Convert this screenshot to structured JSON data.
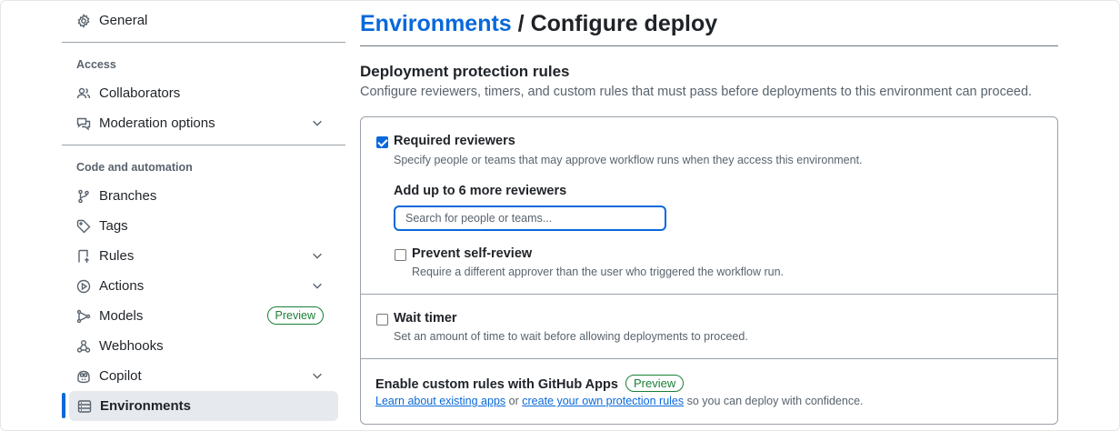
{
  "sidebar": {
    "general": "General",
    "access_heading": "Access",
    "collaborators": "Collaborators",
    "moderation": "Moderation options",
    "code_heading": "Code and automation",
    "branches": "Branches",
    "tags": "Tags",
    "rules": "Rules",
    "actions": "Actions",
    "models": "Models",
    "models_badge": "Preview",
    "webhooks": "Webhooks",
    "copilot": "Copilot",
    "environments": "Environments"
  },
  "header": {
    "breadcrumb_link": "Environments",
    "separator": "/",
    "current": "Configure deploy"
  },
  "protection": {
    "title": "Deployment protection rules",
    "description": "Configure reviewers, timers, and custom rules that must pass before deployments to this environment can proceed.",
    "required_reviewers": {
      "checked": true,
      "label": "Required reviewers",
      "help": "Specify people or teams that may approve workflow runs when they access this environment.",
      "add_label": "Add up to 6 more reviewers",
      "search_placeholder": "Search for people or teams...",
      "prevent_self_review": {
        "checked": false,
        "label": "Prevent self-review",
        "help": "Require a different approver than the user who triggered the workflow run."
      }
    },
    "wait_timer": {
      "checked": false,
      "label": "Wait timer",
      "help": "Set an amount of time to wait before allowing deployments to proceed."
    },
    "custom_rules": {
      "title": "Enable custom rules with GitHub Apps",
      "badge": "Preview",
      "link1": "Learn about existing apps",
      "mid": "or",
      "link2": "create your own protection rules",
      "tail": "so you can deploy with confidence."
    }
  },
  "colors": {
    "accent": "#0969da",
    "success": "#1a7f37",
    "muted": "#59636e"
  }
}
